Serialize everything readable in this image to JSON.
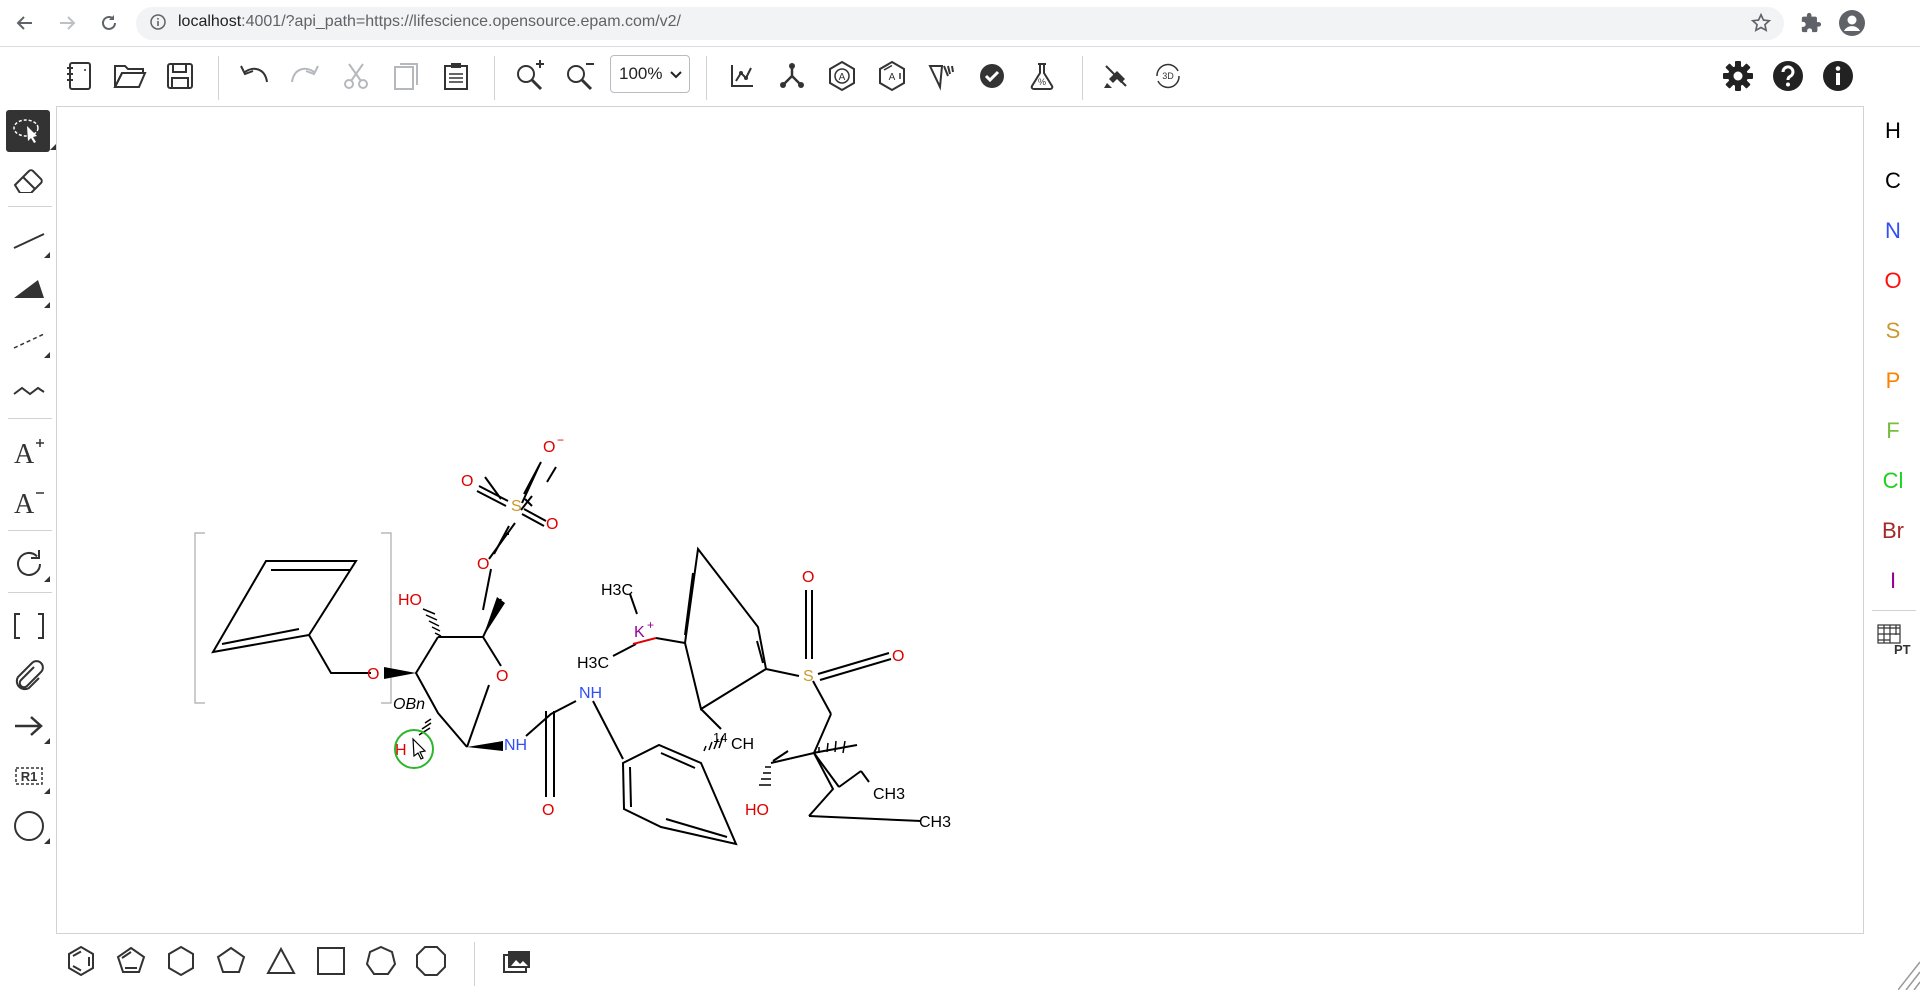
{
  "browser": {
    "url_host": "localhost",
    "url_rest": ":4001/?api_path=https://lifescience.opensource.epam.com/v2/",
    "icons": [
      "back-icon",
      "forward-icon",
      "reload-icon",
      "info-icon",
      "star-icon",
      "extensions-icon",
      "profile-icon"
    ]
  },
  "toolbar": {
    "zoom_value": "100%",
    "icons": [
      "new-document-icon",
      "open-icon",
      "save-icon",
      "undo-icon",
      "redo-icon",
      "cut-icon",
      "copy-icon",
      "paste-icon",
      "zoom-in-icon",
      "zoom-out-icon",
      "layout-icon",
      "clean-icon",
      "aromatize-icon",
      "dearomatize-icon",
      "stereo-icon",
      "check-icon",
      "analyse-icon",
      "miew-icon",
      "3d-icon",
      "settings-icon",
      "help-icon",
      "about-icon"
    ]
  },
  "left_tools": [
    "select",
    "erase",
    "single-bond",
    "wedge-bond",
    "dashed-bond",
    "wavy-bond",
    "text-plus",
    "text-minus",
    "rotate",
    "bracket",
    "attach",
    "reaction-arrow",
    "r-group",
    "shape-circle"
  ],
  "left_labels": {
    "r_group": "R1"
  },
  "atoms": {
    "H": {
      "label": "H",
      "color": "#000000"
    },
    "C": {
      "label": "C",
      "color": "#000000"
    },
    "N": {
      "label": "N",
      "color": "#304ff7"
    },
    "O": {
      "label": "O",
      "color": "#ff0d0d"
    },
    "S": {
      "label": "S",
      "color": "#c99a2e"
    },
    "P": {
      "label": "P",
      "color": "#ff8000"
    },
    "F": {
      "label": "F",
      "color": "#78bc42"
    },
    "Cl": {
      "label": "Cl",
      "color": "#1fd01f"
    },
    "Br": {
      "label": "Br",
      "color": "#a62929"
    },
    "I": {
      "label": "I",
      "color": "#940094"
    },
    "pt_label": "PT"
  },
  "molecule": {
    "labels": {
      "o_minus": "O",
      "minus": "−",
      "o1": "O",
      "s1": "S",
      "o2": "O",
      "o3": "O",
      "ho1": "HO",
      "o_ring": "O",
      "o_bn": "O",
      "obn_label": "OBn",
      "ho2": "H",
      "nh1": "NH",
      "nh2": "NH",
      "o_carbonyl": "O",
      "h3c_top": "H3C",
      "h3c_bot": "H3C",
      "k": "K",
      "k_plus": "+",
      "o_so2_top": "O",
      "s2": "S",
      "o_so2_right": "O",
      "ch14": "14",
      "ch": "CH",
      "ho3": "HO",
      "ch3_a": "CH3",
      "ch3_b": "CH3"
    }
  }
}
